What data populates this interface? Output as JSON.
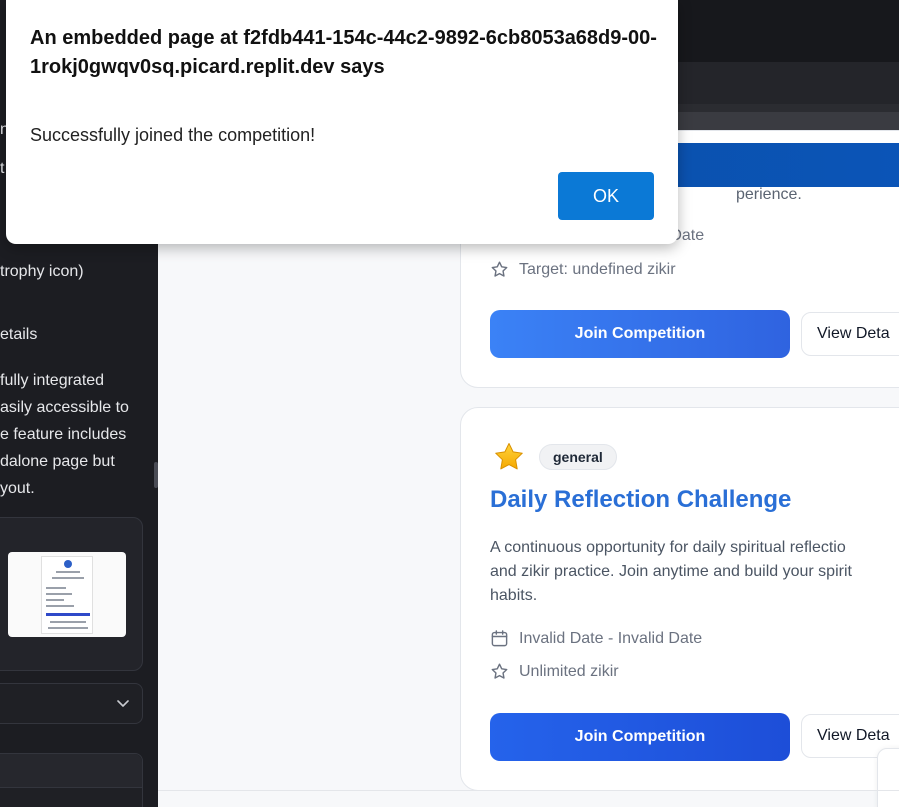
{
  "left_panel": {
    "text_lines": [
      "n",
      "t",
      "trophy icon)",
      "etails",
      "fully integrated",
      "asily accessible to",
      "e feature includes",
      "dalone page but",
      "yout."
    ]
  },
  "dialog": {
    "title": "An embedded page at f2fdb441-154c-44c2-9892-6cb8053a68d9-00-1rokj0gwqv0sq.picard.replit.dev says",
    "message": "Successfully joined the competition!",
    "ok_label": "OK"
  },
  "card1": {
    "description_tail": "perience.",
    "date_tail": "d Date",
    "target": "Target: undefined zikir",
    "join_label": "Join Competition",
    "view_label": "View Deta"
  },
  "card2": {
    "category": "general",
    "title": "Daily Reflection Challenge",
    "description_lines": [
      "A continuous opportunity for daily spiritual reflectio",
      "and zikir practice. Join anytime and build your spirit",
      "habits."
    ],
    "date_range": "Invalid Date - Invalid Date",
    "target": "Unlimited zikir",
    "join_label": "Join Competition",
    "view_label": "View Deta"
  },
  "icons": {
    "category_icon": "star-emoji-icon",
    "date_icon": "calendar-icon",
    "target_icon": "star-outline-icon",
    "select_icon": "chevron-down-icon"
  },
  "colors": {
    "accent_blue": "#2563eb",
    "title_blue": "#2a6fd6",
    "dialog_ok": "#0b79d6",
    "dark_panel": "#1c1d22"
  }
}
